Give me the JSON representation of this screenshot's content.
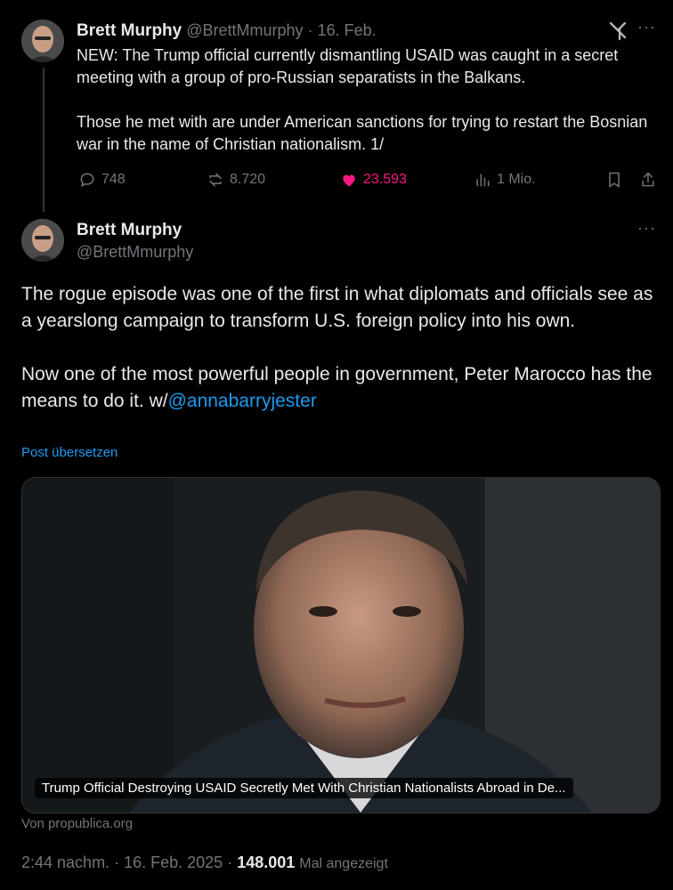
{
  "tweet1": {
    "author_name": "Brett Murphy",
    "handle": "@BrettMmurphy",
    "separator": "·",
    "date": "16. Feb.",
    "paragraph1": "NEW: The Trump official currently dismantling USAID was caught in a secret meeting with a group of pro-Russian separatists in the Balkans.",
    "paragraph2": "Those he met with are under American sanctions for trying to restart the Bosnian war in the name of Christian nationalism. 1/",
    "replies": "748",
    "reposts": "8.720",
    "likes": "23.593",
    "views": "1 Mio.",
    "liked": true,
    "grok_icon": "grok-icon",
    "more_icon": "more-icon"
  },
  "tweet2": {
    "author_name": "Brett Murphy",
    "handle": "@BrettMmurphy",
    "paragraph1": "The rogue episode was one of the first in what diplomats and officials see as a yearslong campaign to transform U.S. foreign policy into his own.",
    "paragraph2_text": "Now one of the most powerful people in government, Peter Marocco has the means to do it. w/",
    "mention": "@annabarryjester",
    "translate_label": "Post übersetzen",
    "card_title": "Trump Official Destroying USAID Secretly Met With Christian Nationalists Abroad in De...",
    "card_source": "Von propublica.org",
    "time": "2:44 nachm.",
    "date": "16. Feb. 2025",
    "views_count": "148.001",
    "views_label": "Mal angezeigt"
  },
  "colors": {
    "background": "#000000",
    "text": "#e7e9ea",
    "muted": "#71767b",
    "link": "#1d9bf0",
    "like": "#f91880"
  }
}
